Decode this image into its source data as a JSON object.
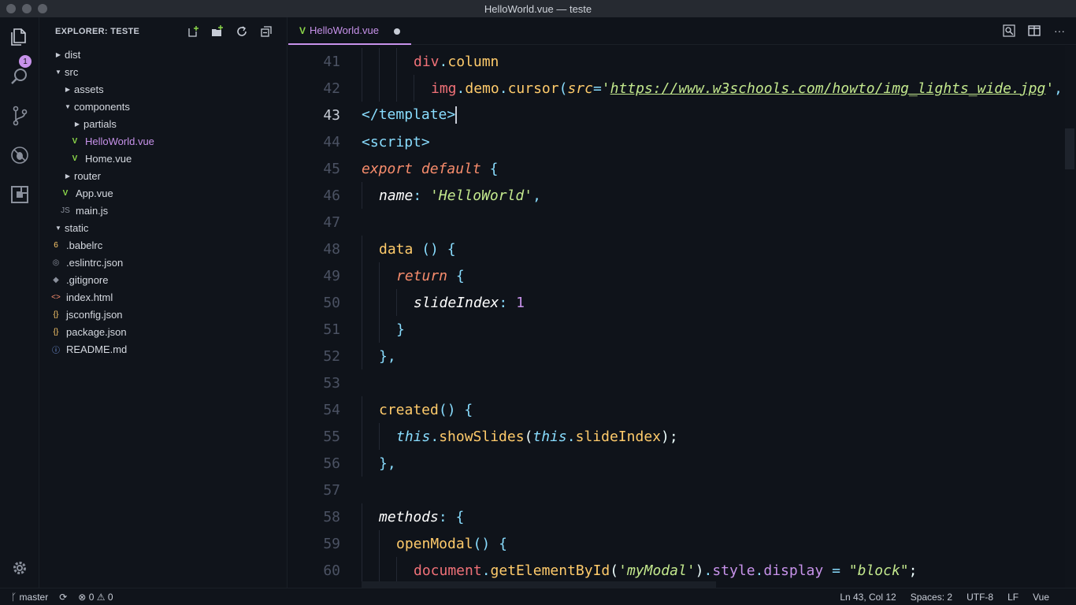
{
  "window": {
    "title": "HelloWorld.vue — teste"
  },
  "activity_bar": {
    "explorer_badge": "1"
  },
  "sidebar": {
    "header": "EXPLORER: TESTE",
    "tree": [
      {
        "label": "dist",
        "type": "folder",
        "expanded": false,
        "depth": 0
      },
      {
        "label": "src",
        "type": "folder",
        "expanded": true,
        "depth": 0
      },
      {
        "label": "assets",
        "type": "folder",
        "expanded": false,
        "depth": 1
      },
      {
        "label": "components",
        "type": "folder",
        "expanded": true,
        "depth": 1
      },
      {
        "label": "partials",
        "type": "folder",
        "expanded": false,
        "depth": 2
      },
      {
        "label": "HelloWorld.vue",
        "type": "vue",
        "depth": 2,
        "active": true
      },
      {
        "label": "Home.vue",
        "type": "vue",
        "depth": 2
      },
      {
        "label": "router",
        "type": "folder",
        "expanded": false,
        "depth": 1
      },
      {
        "label": "App.vue",
        "type": "vue",
        "depth": 1
      },
      {
        "label": "main.js",
        "type": "js",
        "depth": 1
      },
      {
        "label": "static",
        "type": "folder",
        "expanded": true,
        "depth": 0
      },
      {
        "label": ".babelrc",
        "type": "babel",
        "depth": 0
      },
      {
        "label": ".eslintrc.json",
        "type": "eslint",
        "depth": 0
      },
      {
        "label": ".gitignore",
        "type": "git",
        "depth": 0
      },
      {
        "label": "index.html",
        "type": "html",
        "depth": 0
      },
      {
        "label": "jsconfig.json",
        "type": "json",
        "depth": 0
      },
      {
        "label": "package.json",
        "type": "json",
        "depth": 0
      },
      {
        "label": "README.md",
        "type": "info",
        "depth": 0
      }
    ]
  },
  "tabs": [
    {
      "label": "HelloWorld.vue",
      "dirty": true
    }
  ],
  "editor": {
    "line_numbers": [
      "41",
      "42",
      "43",
      "44",
      "45",
      "46",
      "47",
      "48",
      "49",
      "50",
      "51",
      "52",
      "53",
      "54",
      "55",
      "56",
      "57",
      "58",
      "59",
      "60"
    ],
    "current_line": "43"
  },
  "status": {
    "branch": "master",
    "errors": "0",
    "warnings": "0",
    "position": "Ln 43, Col 12",
    "spaces": "Spaces: 2",
    "encoding": "UTF-8",
    "eol": "LF",
    "language": "Vue"
  },
  "colors": {
    "accent": "#c792ea",
    "vue_green": "#8bd649",
    "background": "#0f131a"
  }
}
